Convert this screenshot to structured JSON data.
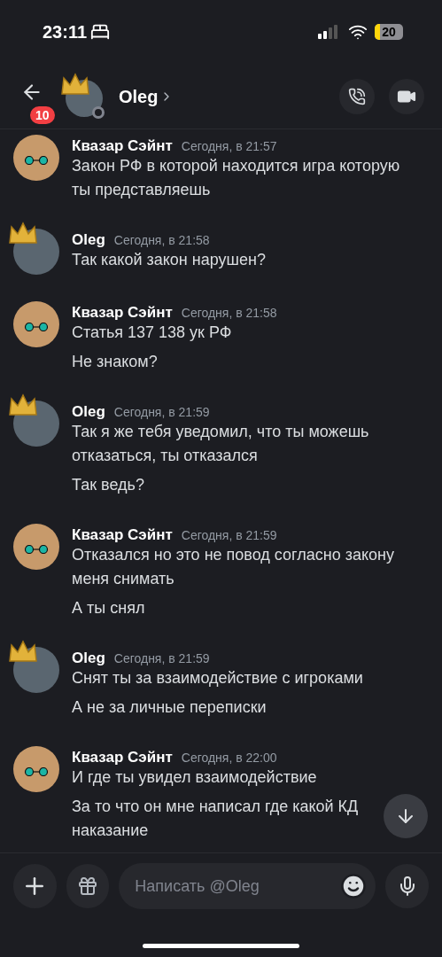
{
  "status_bar": {
    "time": "23:11",
    "battery": "20"
  },
  "header": {
    "back_badge": "10",
    "title": "Oleg"
  },
  "messages": [
    {
      "author": "Квазар Сэйнт",
      "crown": false,
      "time": "Сегодня, в 21:57",
      "items": [
        {
          "text": "Закон РФ в которой находится игра которую ты представляешь"
        }
      ]
    },
    {
      "author": "Oleg",
      "crown": true,
      "time": "Сегодня, в 21:58",
      "items": [
        {
          "text": "Так какой закон нарушен?"
        }
      ]
    },
    {
      "author": "Квазар Сэйнт",
      "crown": false,
      "time": "Сегодня, в 21:58",
      "items": [
        {
          "text": "Статья 137 138 ук РФ"
        },
        {
          "text": "Не знаком?"
        }
      ]
    },
    {
      "author": "Oleg",
      "crown": true,
      "time": "Сегодня, в 21:59",
      "items": [
        {
          "text": "Так я же тебя уведомил, что ты можешь отказаться, ты отказался"
        },
        {
          "text": "Так ведь?"
        }
      ]
    },
    {
      "author": "Квазар Сэйнт",
      "crown": false,
      "time": "Сегодня, в 21:59",
      "items": [
        {
          "text": "Отказался но это не повод согласно закону меня снимать"
        },
        {
          "text": "А ты снял"
        }
      ]
    },
    {
      "author": "Oleg",
      "crown": true,
      "time": "Сегодня, в 21:59",
      "items": [
        {
          "text": "Снят ты за взаимодействие с игроками"
        },
        {
          "text": "А не за личные переписки"
        }
      ]
    },
    {
      "author": "Квазар Сэйнт",
      "crown": false,
      "time": "Сегодня, в 22:00",
      "items": [
        {
          "text": "И где ты увидел взаимодействие"
        },
        {
          "text": "За то что он мне написал где какой КД",
          "after_cover": "наказание"
        }
      ]
    }
  ],
  "composer": {
    "placeholder": "Написать @Oleg"
  }
}
